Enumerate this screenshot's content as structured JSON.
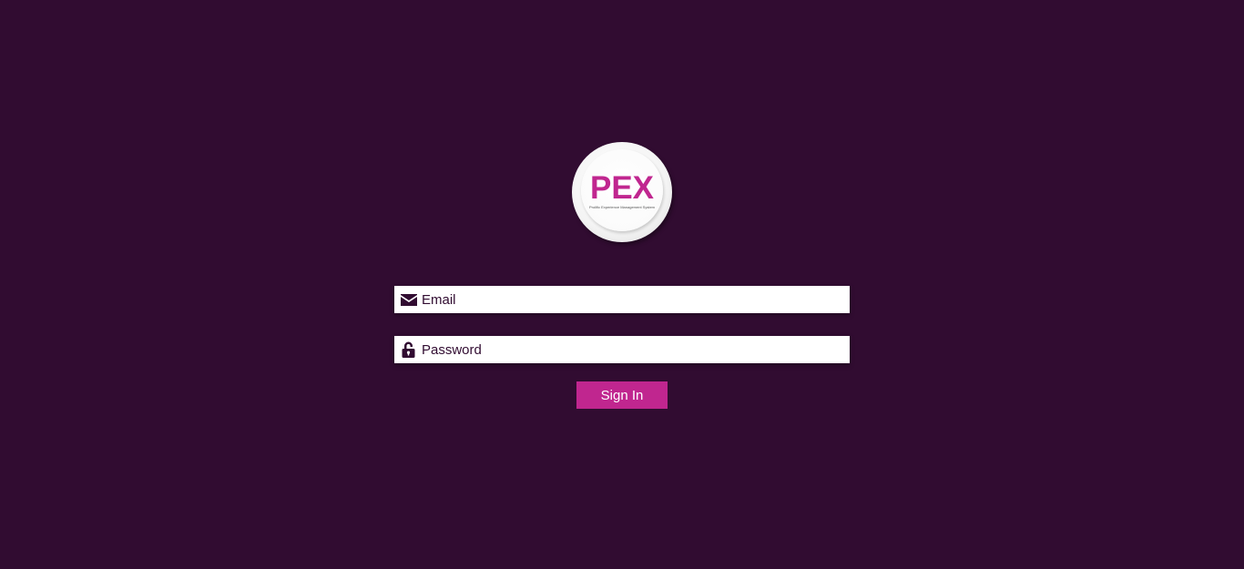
{
  "logo": {
    "brand": "PEX",
    "tagline": "Prolific Experience Management System"
  },
  "form": {
    "email_placeholder": "Email",
    "email_icon": "envelope-icon",
    "password_placeholder": "Password",
    "password_icon": "unlock-icon",
    "signin_label": "Sign In"
  },
  "colors": {
    "background": "#310c31",
    "accent": "#c0268f",
    "field": "#ffffff"
  }
}
